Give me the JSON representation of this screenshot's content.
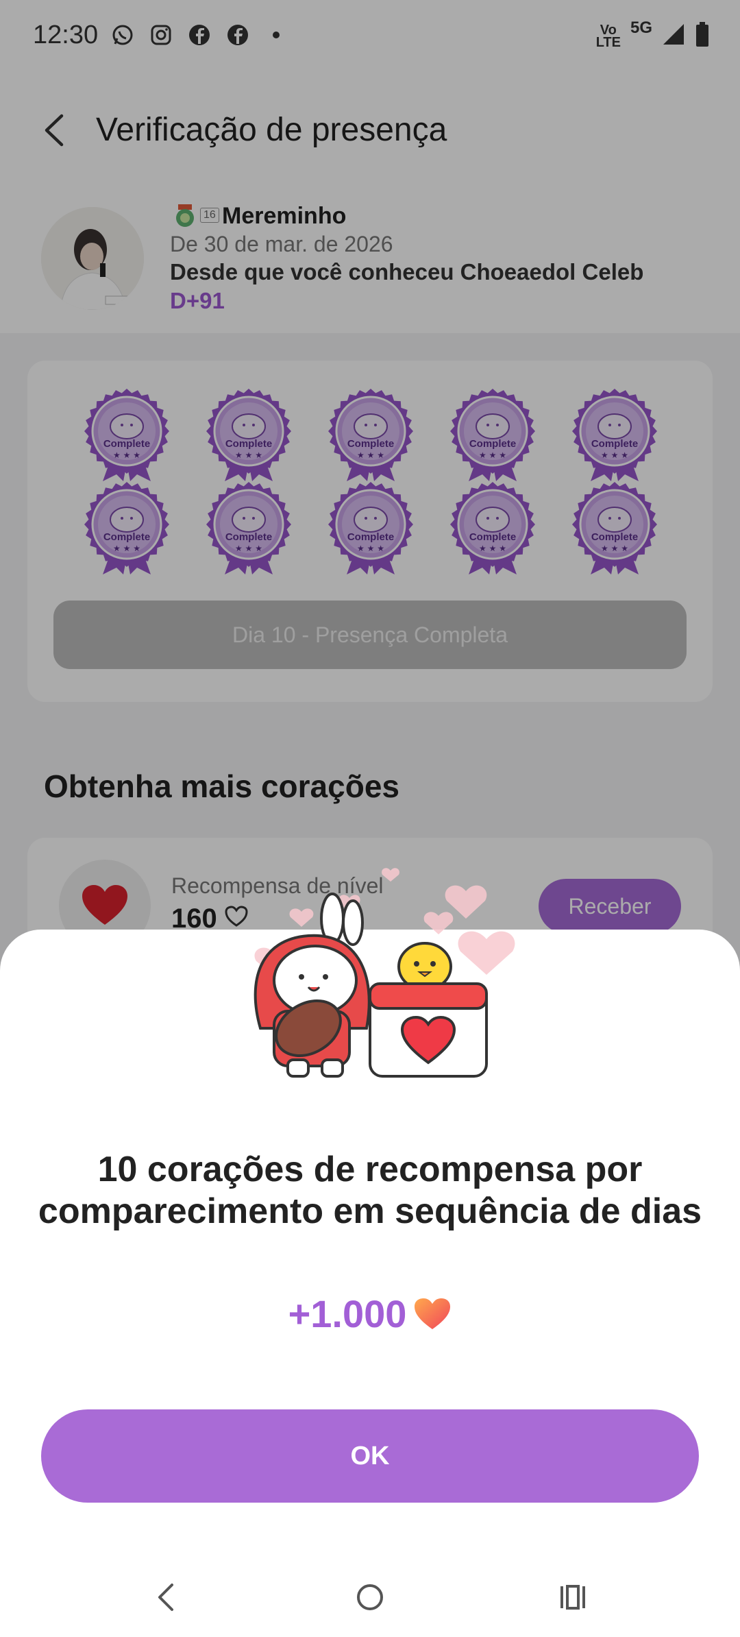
{
  "status_bar": {
    "time": "12:30",
    "icons_left": [
      "whatsapp-icon",
      "instagram-icon",
      "facebook-icon",
      "facebook-icon",
      "dot-icon"
    ],
    "network_label": "5G",
    "volte_label_top": "Vo",
    "volte_label_bottom": "LTE"
  },
  "header": {
    "title": "Verificação de presença"
  },
  "profile": {
    "level": "16",
    "name": "Mereminho",
    "date": "De 30 de mar. de 2026",
    "since": "Desde que você conheceu Choeaedol Celeb",
    "dday": "D+91"
  },
  "attendance": {
    "stamp_label": "Complete",
    "stamp_count": 10,
    "button_label": "Dia 10 - Presença Completa"
  },
  "section": {
    "title": "Obtenha mais corações"
  },
  "reward": {
    "title": "Recompensa de nível",
    "value": "160",
    "button_label": "Receber"
  },
  "sheet": {
    "title": "10 corações de recompensa por comparecimento em sequência de dias",
    "amount": "+1.000",
    "ok_label": "OK"
  },
  "colors": {
    "accent": "#a96bd6",
    "stamp": "#9656c9",
    "heart": "#f0455a"
  }
}
